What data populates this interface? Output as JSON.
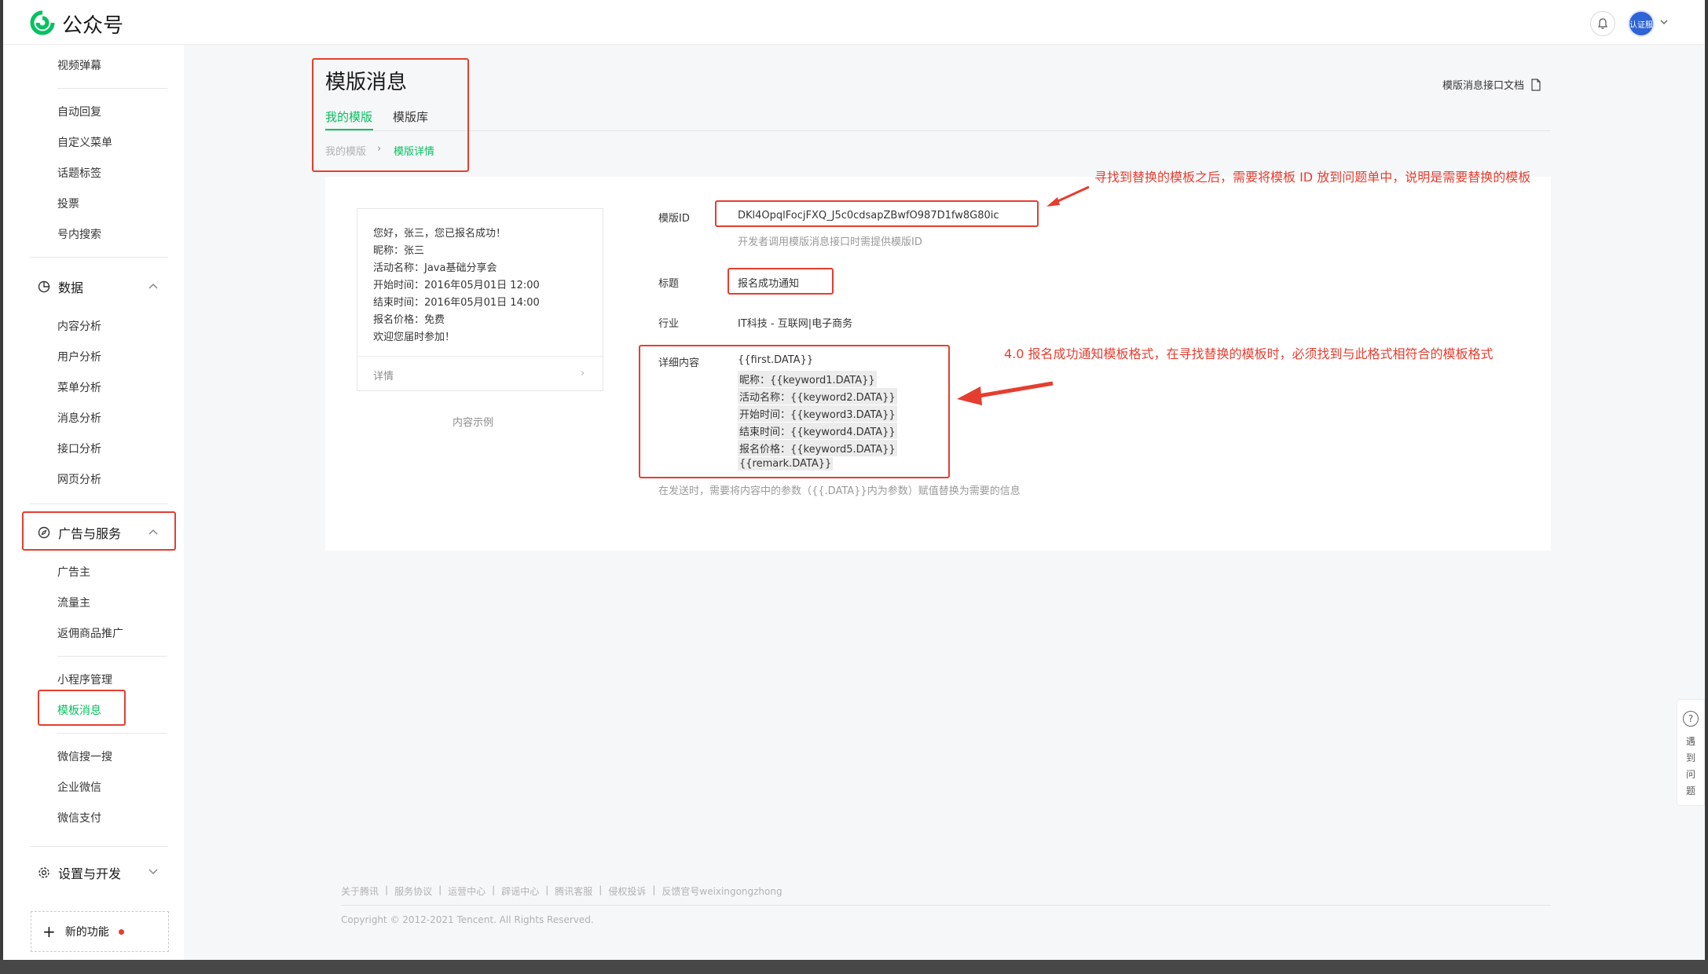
{
  "header": {
    "brand": "公众号",
    "avatar_text": "认证服"
  },
  "sidebar": {
    "top_items": [
      "视频弹幕",
      "自动回复",
      "自定义菜单",
      "话题标签",
      "投票",
      "号内搜索"
    ],
    "data_group": "数据",
    "data_items": [
      "内容分析",
      "用户分析",
      "菜单分析",
      "消息分析",
      "接口分析",
      "网页分析"
    ],
    "ads_group": "广告与服务",
    "ads_items": [
      "广告主",
      "流量主",
      "返佣商品推广"
    ],
    "mini_items": [
      "小程序管理",
      "模板消息"
    ],
    "other_items": [
      "微信搜一搜",
      "企业微信",
      "微信支付"
    ],
    "settings_group": "设置与开发",
    "new_features": "新的功能"
  },
  "main": {
    "title": "模版消息",
    "tabs": [
      "我的模版",
      "模版库"
    ],
    "breadcrumb": [
      "我的模版",
      "模版详情"
    ],
    "doc_link": "模版消息接口文档"
  },
  "preview": {
    "lines": [
      "您好，张三，您已报名成功！",
      "昵称：张三",
      "活动名称：Java基础分享会",
      "开始时间：2016年05月01日 12:00",
      "结束时间：2016年05月01日 14:00",
      "报名价格：免费",
      "欢迎您届时参加！"
    ],
    "detail": "详情",
    "caption": "内容示例"
  },
  "fields": {
    "id_label": "模版ID",
    "id_value": "DKl4OpqlFocjFXQ_J5c0cdsapZBwfO987D1fw8G80ic",
    "id_hint": "开发者调用模版消息接口时需提供模版ID",
    "title_label": "标题",
    "title_value": "报名成功通知",
    "industry_label": "行业",
    "industry_value": "IT科技 - 互联网|电子商务",
    "content_label": "详细内容",
    "content_lines": [
      "{{first.DATA}}",
      "昵称：{{keyword1.DATA}}",
      "活动名称：{{keyword2.DATA}}",
      "开始时间：{{keyword3.DATA}}",
      "结束时间：{{keyword4.DATA}}",
      "报名价格：{{keyword5.DATA}}",
      "{{remark.DATA}}"
    ],
    "content_hint": "在发送时，需要将内容中的参数（{{.DATA}}内为参数）赋值替换为需要的信息"
  },
  "annotations": {
    "top": "寻找到替换的模板之后，需要将模板 ID 放到问题单中，说明是需要替换的模板",
    "middle": "4.0 报名成功通知模板格式，在寻找替换的模板时，必须找到与此格式相符合的模板格式"
  },
  "footer": {
    "links": [
      "关于腾讯",
      "服务协议",
      "运营中心",
      "辟谣中心",
      "腾讯客服",
      "侵权投诉",
      "反馈官号weixingongzhong"
    ],
    "copyright": "Copyright © 2012-2021 Tencent. All Rights Reserved."
  },
  "help": {
    "chars": [
      "遇",
      "到",
      "问",
      "题"
    ]
  },
  "colors": {
    "accent": "#07c160",
    "annotation": "#e53e30"
  }
}
